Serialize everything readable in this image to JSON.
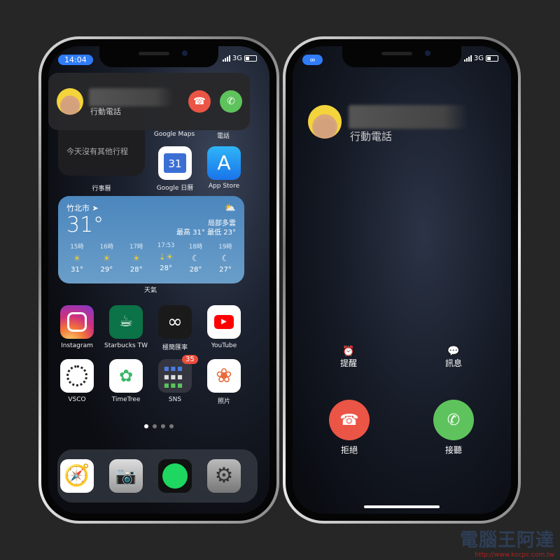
{
  "left": {
    "time": "14:04",
    "network": "3G",
    "call_banner": {
      "subtitle": "行動電話",
      "decline_icon": "phone-down-icon",
      "accept_icon": "phone-icon"
    },
    "hidden_labels": [
      "Google Maps",
      "電話"
    ],
    "calendar_widget": {
      "text": "今天沒有其他行程",
      "label": "行事曆"
    },
    "apps_row1": [
      {
        "label": "Google 日曆",
        "icon_text": "31"
      },
      {
        "label": "App Store"
      }
    ],
    "weather": {
      "city": "竹北市",
      "temp": "31°",
      "condition": "局部多雲",
      "hilo": "最高 31° 最低 23°",
      "label": "天氣",
      "hours": [
        {
          "t": "15時",
          "icon": "sun",
          "v": "31°"
        },
        {
          "t": "16時",
          "icon": "sun",
          "v": "29°"
        },
        {
          "t": "17時",
          "icon": "sun",
          "v": "28°"
        },
        {
          "t": "17:53",
          "icon": "sunset",
          "v": "28°"
        },
        {
          "t": "18時",
          "icon": "moon",
          "v": "28°"
        },
        {
          "t": "19時",
          "icon": "moon",
          "v": "27°"
        }
      ]
    },
    "apps_row3": [
      {
        "label": "Instagram"
      },
      {
        "label": "Starbucks TW"
      },
      {
        "label": "極簡匯率"
      },
      {
        "label": "YouTube"
      }
    ],
    "apps_row4": [
      {
        "label": "VSCO"
      },
      {
        "label": "TimeTree"
      },
      {
        "label": "SNS",
        "badge": "35"
      },
      {
        "label": "照片"
      }
    ],
    "page_count": 4,
    "current_page": 1,
    "dock": [
      "safari",
      "camera",
      "spotify",
      "settings"
    ]
  },
  "right": {
    "network": "3G",
    "subtitle": "行動電話",
    "remind": "提醒",
    "message": "訊息",
    "decline": "拒絕",
    "accept": "接聽"
  },
  "watermark": {
    "name": "電腦王阿達",
    "url": "http://www.kocpc.com.tw"
  },
  "colors": {
    "red": "#eb5545",
    "green": "#5ec35c",
    "pill": "#2f7cf6"
  }
}
